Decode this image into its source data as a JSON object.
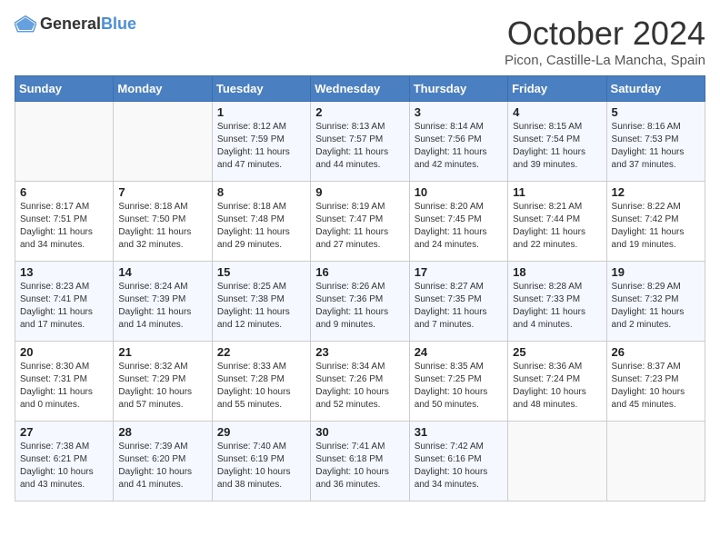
{
  "header": {
    "logo_general": "General",
    "logo_blue": "Blue",
    "month": "October 2024",
    "location": "Picon, Castille-La Mancha, Spain"
  },
  "days_of_week": [
    "Sunday",
    "Monday",
    "Tuesday",
    "Wednesday",
    "Thursday",
    "Friday",
    "Saturday"
  ],
  "weeks": [
    [
      {
        "day": "",
        "info": ""
      },
      {
        "day": "",
        "info": ""
      },
      {
        "day": "1",
        "info": "Sunrise: 8:12 AM\nSunset: 7:59 PM\nDaylight: 11 hours and 47 minutes."
      },
      {
        "day": "2",
        "info": "Sunrise: 8:13 AM\nSunset: 7:57 PM\nDaylight: 11 hours and 44 minutes."
      },
      {
        "day": "3",
        "info": "Sunrise: 8:14 AM\nSunset: 7:56 PM\nDaylight: 11 hours and 42 minutes."
      },
      {
        "day": "4",
        "info": "Sunrise: 8:15 AM\nSunset: 7:54 PM\nDaylight: 11 hours and 39 minutes."
      },
      {
        "day": "5",
        "info": "Sunrise: 8:16 AM\nSunset: 7:53 PM\nDaylight: 11 hours and 37 minutes."
      }
    ],
    [
      {
        "day": "6",
        "info": "Sunrise: 8:17 AM\nSunset: 7:51 PM\nDaylight: 11 hours and 34 minutes."
      },
      {
        "day": "7",
        "info": "Sunrise: 8:18 AM\nSunset: 7:50 PM\nDaylight: 11 hours and 32 minutes."
      },
      {
        "day": "8",
        "info": "Sunrise: 8:18 AM\nSunset: 7:48 PM\nDaylight: 11 hours and 29 minutes."
      },
      {
        "day": "9",
        "info": "Sunrise: 8:19 AM\nSunset: 7:47 PM\nDaylight: 11 hours and 27 minutes."
      },
      {
        "day": "10",
        "info": "Sunrise: 8:20 AM\nSunset: 7:45 PM\nDaylight: 11 hours and 24 minutes."
      },
      {
        "day": "11",
        "info": "Sunrise: 8:21 AM\nSunset: 7:44 PM\nDaylight: 11 hours and 22 minutes."
      },
      {
        "day": "12",
        "info": "Sunrise: 8:22 AM\nSunset: 7:42 PM\nDaylight: 11 hours and 19 minutes."
      }
    ],
    [
      {
        "day": "13",
        "info": "Sunrise: 8:23 AM\nSunset: 7:41 PM\nDaylight: 11 hours and 17 minutes."
      },
      {
        "day": "14",
        "info": "Sunrise: 8:24 AM\nSunset: 7:39 PM\nDaylight: 11 hours and 14 minutes."
      },
      {
        "day": "15",
        "info": "Sunrise: 8:25 AM\nSunset: 7:38 PM\nDaylight: 11 hours and 12 minutes."
      },
      {
        "day": "16",
        "info": "Sunrise: 8:26 AM\nSunset: 7:36 PM\nDaylight: 11 hours and 9 minutes."
      },
      {
        "day": "17",
        "info": "Sunrise: 8:27 AM\nSunset: 7:35 PM\nDaylight: 11 hours and 7 minutes."
      },
      {
        "day": "18",
        "info": "Sunrise: 8:28 AM\nSunset: 7:33 PM\nDaylight: 11 hours and 4 minutes."
      },
      {
        "day": "19",
        "info": "Sunrise: 8:29 AM\nSunset: 7:32 PM\nDaylight: 11 hours and 2 minutes."
      }
    ],
    [
      {
        "day": "20",
        "info": "Sunrise: 8:30 AM\nSunset: 7:31 PM\nDaylight: 11 hours and 0 minutes."
      },
      {
        "day": "21",
        "info": "Sunrise: 8:32 AM\nSunset: 7:29 PM\nDaylight: 10 hours and 57 minutes."
      },
      {
        "day": "22",
        "info": "Sunrise: 8:33 AM\nSunset: 7:28 PM\nDaylight: 10 hours and 55 minutes."
      },
      {
        "day": "23",
        "info": "Sunrise: 8:34 AM\nSunset: 7:26 PM\nDaylight: 10 hours and 52 minutes."
      },
      {
        "day": "24",
        "info": "Sunrise: 8:35 AM\nSunset: 7:25 PM\nDaylight: 10 hours and 50 minutes."
      },
      {
        "day": "25",
        "info": "Sunrise: 8:36 AM\nSunset: 7:24 PM\nDaylight: 10 hours and 48 minutes."
      },
      {
        "day": "26",
        "info": "Sunrise: 8:37 AM\nSunset: 7:23 PM\nDaylight: 10 hours and 45 minutes."
      }
    ],
    [
      {
        "day": "27",
        "info": "Sunrise: 7:38 AM\nSunset: 6:21 PM\nDaylight: 10 hours and 43 minutes."
      },
      {
        "day": "28",
        "info": "Sunrise: 7:39 AM\nSunset: 6:20 PM\nDaylight: 10 hours and 41 minutes."
      },
      {
        "day": "29",
        "info": "Sunrise: 7:40 AM\nSunset: 6:19 PM\nDaylight: 10 hours and 38 minutes."
      },
      {
        "day": "30",
        "info": "Sunrise: 7:41 AM\nSunset: 6:18 PM\nDaylight: 10 hours and 36 minutes."
      },
      {
        "day": "31",
        "info": "Sunrise: 7:42 AM\nSunset: 6:16 PM\nDaylight: 10 hours and 34 minutes."
      },
      {
        "day": "",
        "info": ""
      },
      {
        "day": "",
        "info": ""
      }
    ]
  ]
}
